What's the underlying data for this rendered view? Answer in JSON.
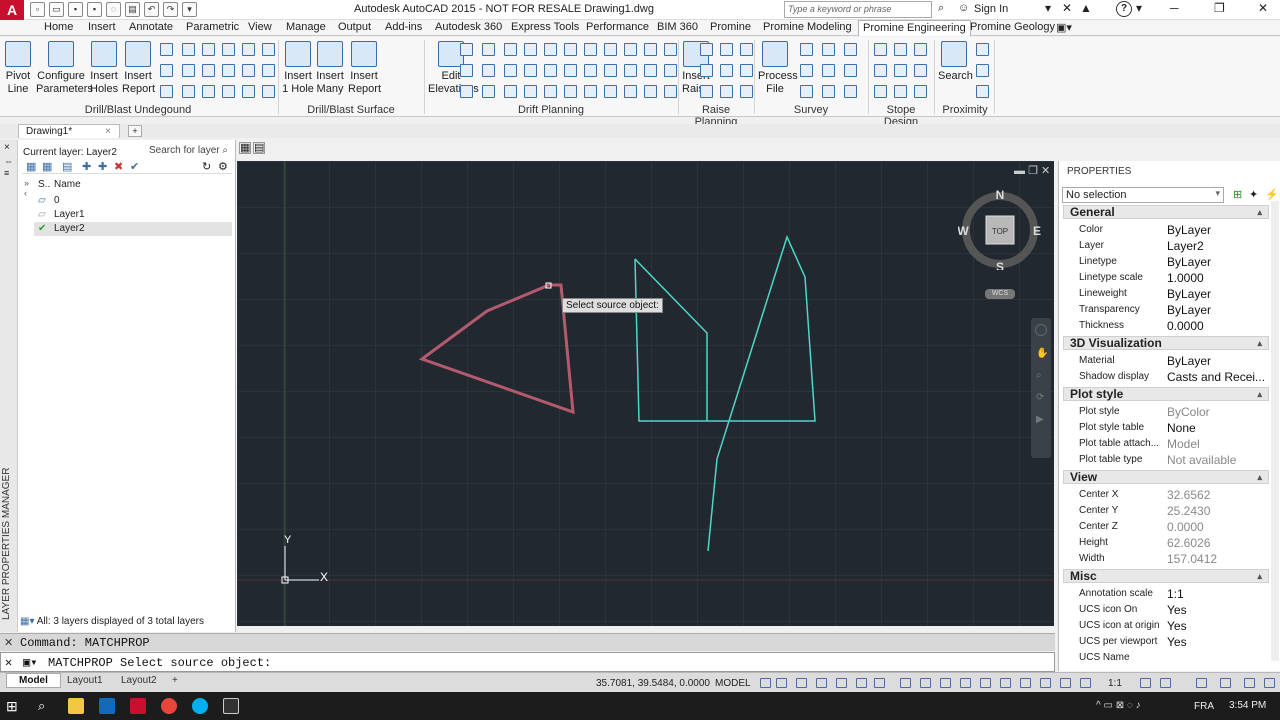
{
  "titlebar": {
    "logo": "A",
    "title": "Autodesk AutoCAD 2015 - NOT FOR RESALE    Drawing1.dwg",
    "search_placeholder": "Type a keyword or phrase",
    "signin": "Sign In",
    "help": "?"
  },
  "ribbon_tabs": [
    "Home",
    "Insert",
    "Annotate",
    "Parametric",
    "View",
    "Manage",
    "Output",
    "Add-ins",
    "Autodesk 360",
    "Express Tools",
    "Performance",
    "BIM 360",
    "Promine",
    "Promine Modeling",
    "Promine Engineering",
    "Promine Geology"
  ],
  "active_tab": "Promine Engineering",
  "ribbon": {
    "big_buttons": [
      {
        "line1": "Pivot",
        "line2": "Line"
      },
      {
        "line1": "Configure",
        "line2": "Parameters"
      },
      {
        "line1": "Insert",
        "line2": "Holes"
      },
      {
        "line1": "Insert",
        "line2": "Report"
      },
      {
        "line1": "Insert",
        "line2": "1 Hole"
      },
      {
        "line1": "Insert",
        "line2": "Many"
      },
      {
        "line1": "Insert",
        "line2": "Report"
      },
      {
        "line1": "Edit",
        "line2": "Elevations"
      },
      {
        "line1": "Insert",
        "line2": "Raise"
      },
      {
        "line1": "Process",
        "line2": "File"
      },
      {
        "line1": "Search",
        "line2": ""
      }
    ],
    "panels": [
      "Drill/Blast Undegound",
      "Drill/Blast Surface",
      "Drift Planning",
      "Raise Planning",
      "Survey",
      "Stope Design",
      "Proximity"
    ]
  },
  "file_tabs": {
    "active": "Drawing1*"
  },
  "layer_panel": {
    "vertical_title": "LAYER PROPERTIES MANAGER",
    "current_layer": "Current layer: Layer2",
    "search_placeholder": "Search for layer",
    "col_status": "S..",
    "col_name": "Name",
    "layers": [
      {
        "name": "0",
        "current": false
      },
      {
        "name": "Layer1",
        "current": false
      },
      {
        "name": "Layer2",
        "current": true
      }
    ],
    "status": "All: 3 layers displayed of 3 total layers"
  },
  "viewport": {
    "tooltip": "Select source object:",
    "compass": {
      "n": "N",
      "s": "S",
      "e": "E",
      "w": "W",
      "top": "TOP"
    },
    "wcs": "WCS",
    "ucs_y": "Y",
    "ucs_x": "X"
  },
  "properties": {
    "title": "PROPERTIES",
    "selection": "No selection",
    "sections": [
      {
        "name": "General",
        "rows": [
          {
            "k": "Color",
            "v": "ByLayer",
            "gray": false
          },
          {
            "k": "Layer",
            "v": "Layer2",
            "gray": false
          },
          {
            "k": "Linetype",
            "v": "ByLayer",
            "gray": false
          },
          {
            "k": "Linetype scale",
            "v": "1.0000",
            "gray": false
          },
          {
            "k": "Lineweight",
            "v": "ByLayer",
            "gray": false
          },
          {
            "k": "Transparency",
            "v": "ByLayer",
            "gray": false
          },
          {
            "k": "Thickness",
            "v": "0.0000",
            "gray": false
          }
        ]
      },
      {
        "name": "3D Visualization",
        "rows": [
          {
            "k": "Material",
            "v": "ByLayer",
            "gray": false
          },
          {
            "k": "Shadow display",
            "v": "Casts and Recei...",
            "gray": false
          }
        ]
      },
      {
        "name": "Plot style",
        "rows": [
          {
            "k": "Plot style",
            "v": "ByColor",
            "gray": true
          },
          {
            "k": "Plot style table",
            "v": "None",
            "gray": false
          },
          {
            "k": "Plot table attach...",
            "v": "Model",
            "gray": true
          },
          {
            "k": "Plot table type",
            "v": "Not available",
            "gray": true
          }
        ]
      },
      {
        "name": "View",
        "rows": [
          {
            "k": "Center X",
            "v": "32.6562",
            "gray": true
          },
          {
            "k": "Center Y",
            "v": "25.2430",
            "gray": true
          },
          {
            "k": "Center Z",
            "v": "0.0000",
            "gray": true
          },
          {
            "k": "Height",
            "v": "62.6026",
            "gray": true
          },
          {
            "k": "Width",
            "v": "157.0412",
            "gray": true
          }
        ]
      },
      {
        "name": "Misc",
        "rows": [
          {
            "k": "Annotation scale",
            "v": "1:1",
            "gray": false
          },
          {
            "k": "UCS icon On",
            "v": "Yes",
            "gray": false
          },
          {
            "k": "UCS icon at origin",
            "v": "Yes",
            "gray": false
          },
          {
            "k": "UCS per viewport",
            "v": "Yes",
            "gray": false
          },
          {
            "k": "UCS Name",
            "v": "",
            "gray": false
          }
        ]
      }
    ]
  },
  "command": {
    "history": "Command: MATCHPROP",
    "prompt": "MATCHPROP Select source object:"
  },
  "status": {
    "tabs": [
      "Model",
      "Layout1",
      "Layout2"
    ],
    "coords": "35.7081, 39.5484, 0.0000",
    "model": "MODEL",
    "scale": "1:1"
  },
  "taskbar": {
    "lang": "FRA",
    "time": "3:54 PM"
  },
  "colors": {
    "layer1": "#b45a6e",
    "layer2": "#4fd6c8",
    "viewport_bg": "#212830"
  }
}
